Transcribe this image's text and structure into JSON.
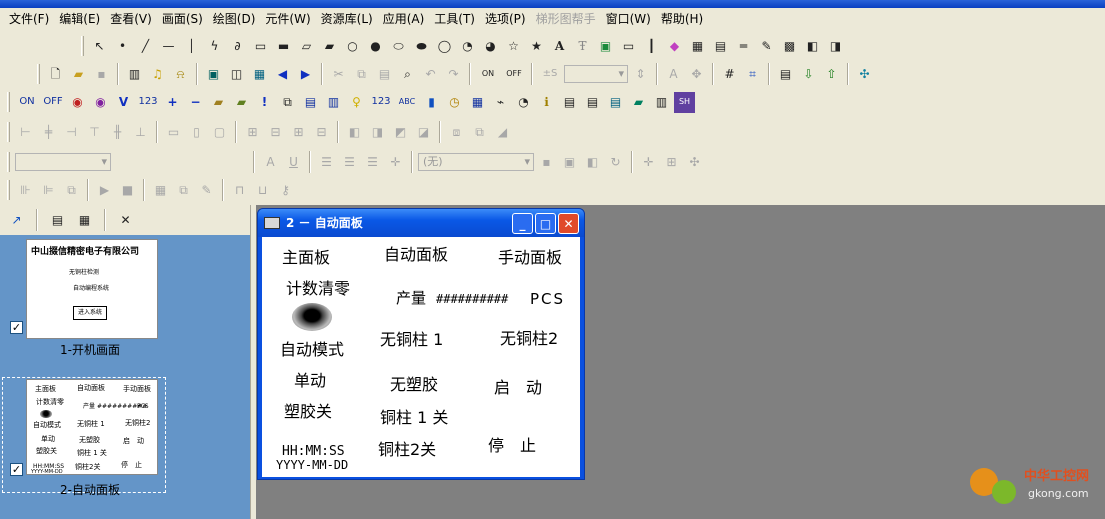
{
  "app": {
    "title_bar_text": ""
  },
  "menu": [
    {
      "label": "文件(F)",
      "disabled": false
    },
    {
      "label": "编辑(E)",
      "disabled": false
    },
    {
      "label": "查看(V)",
      "disabled": false
    },
    {
      "label": "画面(S)",
      "disabled": false
    },
    {
      "label": "绘图(D)",
      "disabled": false
    },
    {
      "label": "元件(W)",
      "disabled": false
    },
    {
      "label": "资源库(L)",
      "disabled": false
    },
    {
      "label": "应用(A)",
      "disabled": false
    },
    {
      "label": "工具(T)",
      "disabled": false
    },
    {
      "label": "选项(P)",
      "disabled": false
    },
    {
      "label": "梯形图帮手",
      "disabled": true
    },
    {
      "label": "窗口(W)",
      "disabled": false
    },
    {
      "label": "帮助(H)",
      "disabled": false
    }
  ],
  "toolbar": {
    "on": "ON",
    "off": "OFF",
    "v": "V",
    "n123": "123",
    "plus": "+",
    "minus": "−",
    "bang": "!",
    "abc": "ABC",
    "on_off_on": "ON",
    "on_off_off": "OFF",
    "nosel": "(无)",
    "font_s": "±S"
  },
  "left_panel": {
    "thumb1": {
      "company": "中山掇信精密电子有限公司",
      "line1": "无铜柱检测",
      "line2": "自动编程系统",
      "enter": "进入系统",
      "label": "1-开机画面"
    },
    "thumb2": {
      "label": "2-自动面板"
    },
    "checkmark": "✓"
  },
  "child_window": {
    "title": "2 － 自动面板",
    "min": "_",
    "max": "□",
    "close": "✕"
  },
  "hmi": {
    "main_panel": "主面板",
    "auto_panel": "自动面板",
    "manual_panel": "手动面板",
    "count_clear": "计数清零",
    "output_label": "产量",
    "output_value": "##########",
    "output_unit": "PCS",
    "no_copper_1": "无铜柱 1",
    "no_copper_2": "无铜柱2",
    "auto_mode": "自动模式",
    "single": "单动",
    "no_plastic": "无塑胶",
    "start": "启　动",
    "plastic_off": "塑胶关",
    "copper1_off": "铜柱 1 关",
    "time": "HH:MM:SS",
    "date": "YYYY-MM-DD",
    "copper2_off": "铜柱2关",
    "stop": "停　止"
  },
  "watermark": {
    "text_cn": "中华工控网",
    "text_en": "gkong.com"
  },
  "colors": {
    "panel_bg": "#6495c8",
    "mdi_bg": "#808080",
    "xp_blue": "#0a50e0",
    "toolbar_bg": "#ece9d8"
  }
}
